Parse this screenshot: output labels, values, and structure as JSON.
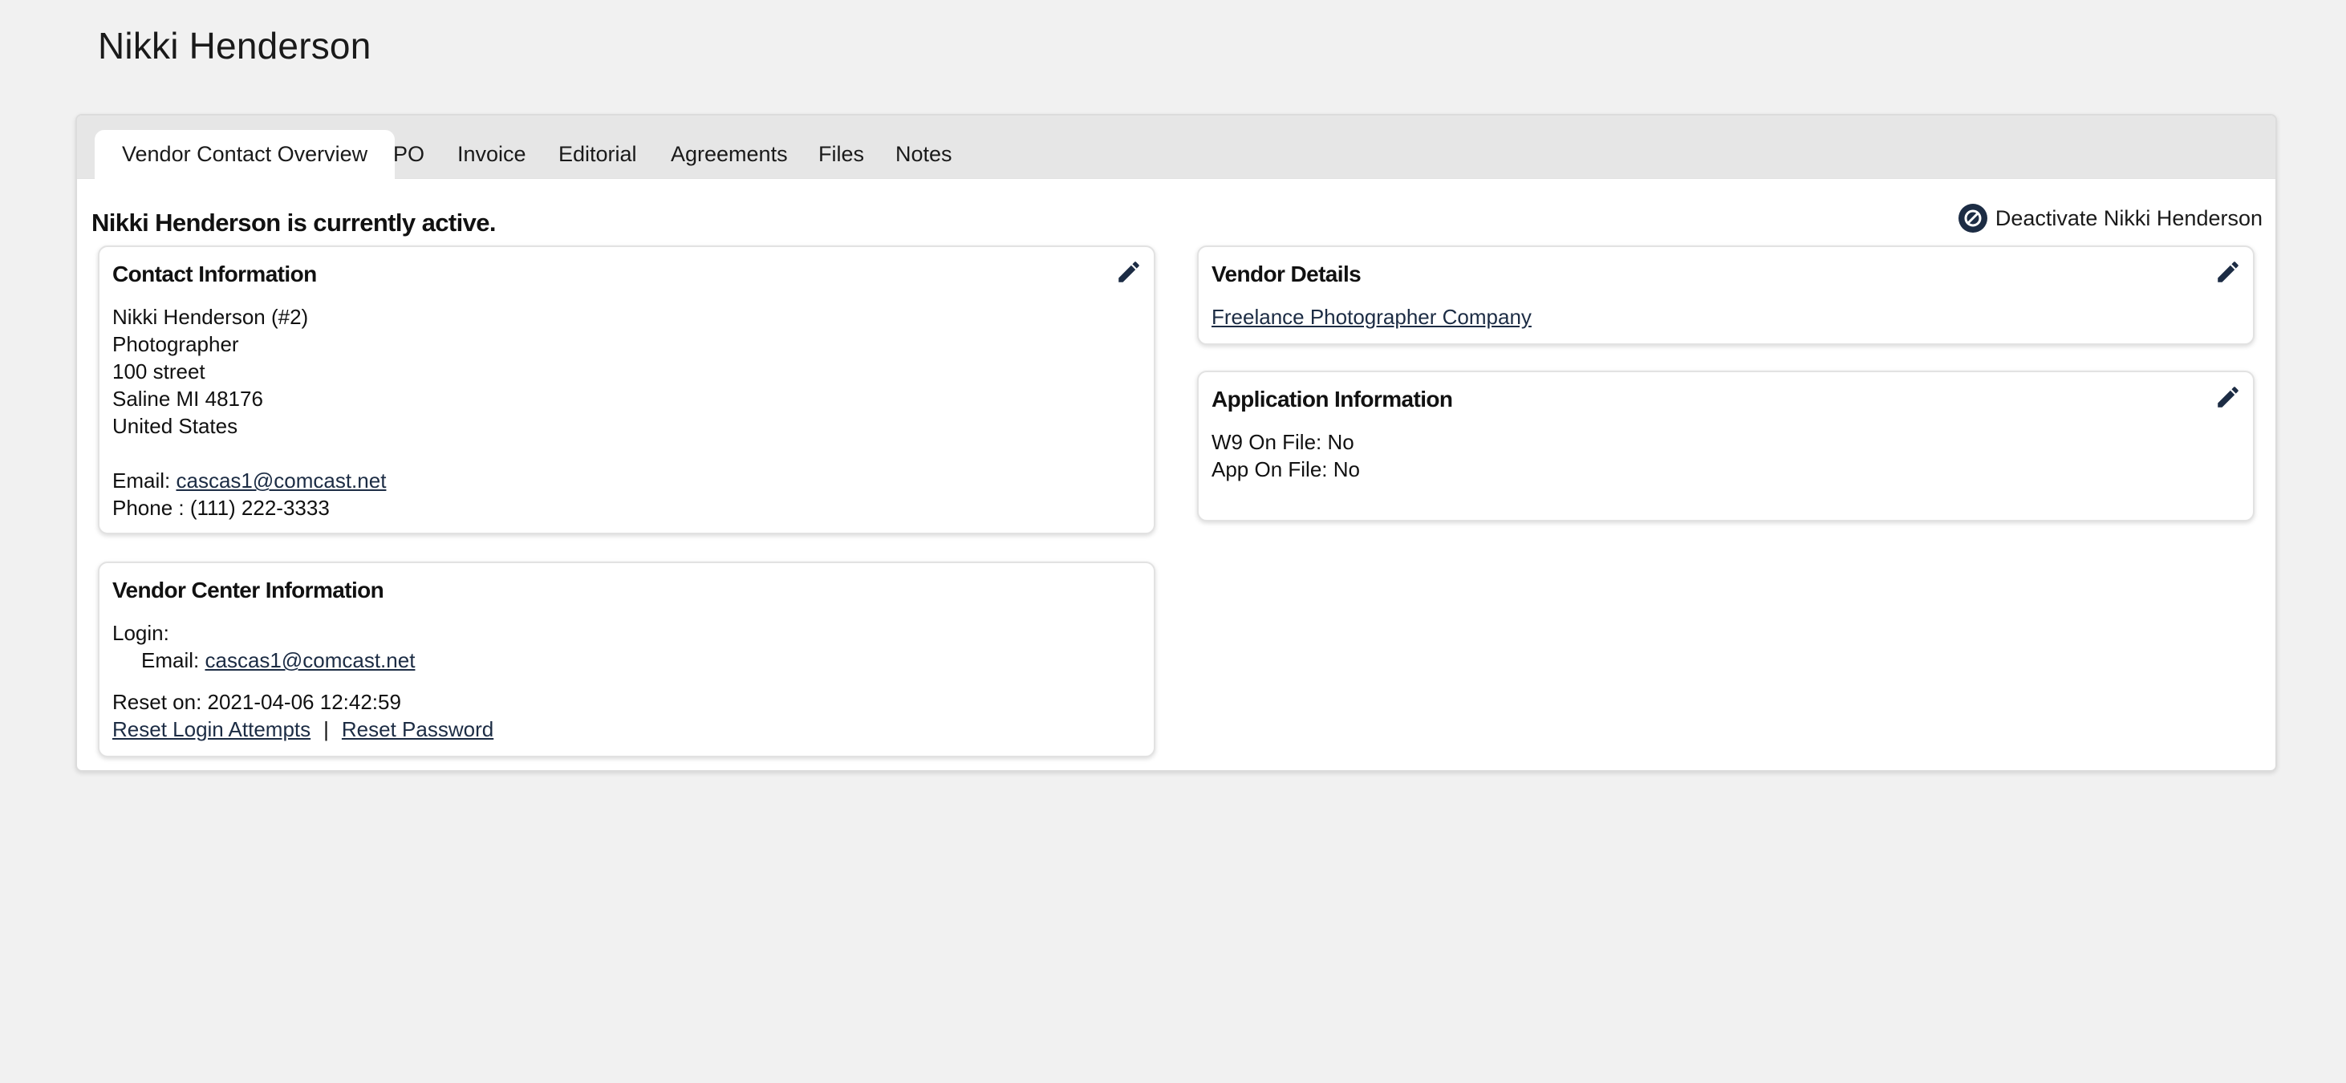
{
  "page": {
    "title": "Nikki Henderson"
  },
  "tabs": [
    {
      "label": "Vendor Contact Overview",
      "active": true
    },
    {
      "label": "PO"
    },
    {
      "label": "Invoice"
    },
    {
      "label": "Editorial"
    },
    {
      "label": "Agreements"
    },
    {
      "label": "Files"
    },
    {
      "label": "Notes"
    }
  ],
  "status": {
    "text": "Nikki Henderson is currently active.",
    "deactivate_label": "Deactivate Nikki Henderson"
  },
  "contact_info": {
    "title": "Contact Information",
    "name_line": "Nikki Henderson (#2)",
    "role": "Photographer",
    "street": "100 street",
    "city_line": "Saline MI 48176",
    "country": "United States",
    "email_label": "Email:",
    "email": "cascas1@comcast.net",
    "phone_line": "Phone : (111) 222-3333"
  },
  "vendor_center": {
    "title": "Vendor Center Information",
    "login_label": "Login:",
    "email_label": "Email:",
    "email": "cascas1@comcast.net",
    "reset_on": "Reset on: 2021-04-06 12:42:59",
    "reset_attempts_label": "Reset Login Attempts",
    "separator": "|",
    "reset_password_label": "Reset Password"
  },
  "vendor_details": {
    "title": "Vendor Details",
    "company": "Freelance Photographer Company"
  },
  "application_info": {
    "title": "Application Information",
    "w9": "W9 On File: No",
    "app": "App On File: No"
  },
  "icons": {
    "edit": "pencil-icon",
    "deactivate": "ban-icon"
  },
  "colors": {
    "background": "#f1f1f1",
    "tab_bar": "#e6e6e6",
    "icon_dark": "#1c2c44",
    "link": "#1c2c44"
  }
}
